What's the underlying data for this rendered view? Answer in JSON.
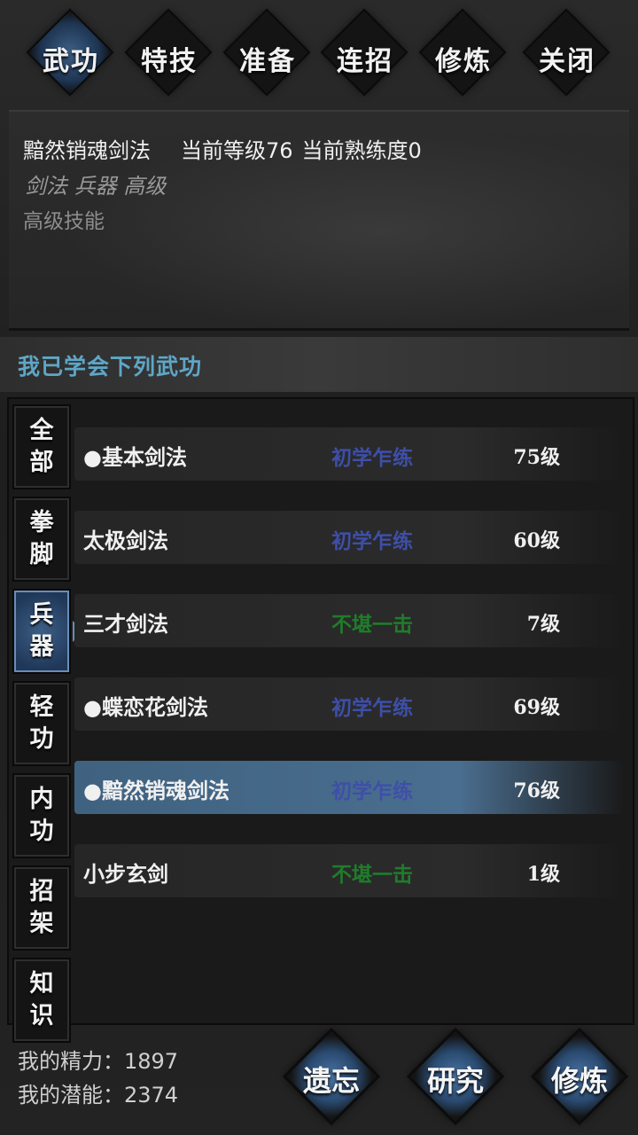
{
  "tabs": [
    {
      "label": "武功",
      "active": true
    },
    {
      "label": "特技",
      "active": false
    },
    {
      "label": "准备",
      "active": false
    },
    {
      "label": "连招",
      "active": false
    },
    {
      "label": "修炼",
      "active": false
    },
    {
      "label": "关闭",
      "active": false
    }
  ],
  "info": {
    "skill_name": "黯然销魂剑法",
    "level_text": "当前等级76",
    "proficiency_text": "当前熟练度0",
    "tags": "剑法 兵器 高级",
    "category": "高级技能"
  },
  "section_title": "我已学会下列武功",
  "categories": [
    {
      "label": "全部",
      "active": false
    },
    {
      "label": "拳脚",
      "active": false
    },
    {
      "label": "兵器",
      "active": true
    },
    {
      "label": "轻功",
      "active": false
    },
    {
      "label": "内功",
      "active": false
    },
    {
      "label": "招架",
      "active": false
    },
    {
      "label": "知识",
      "active": false
    }
  ],
  "skills": [
    {
      "name": "●基本剑法",
      "status": "初学乍练",
      "status_color": "#3e4fa8",
      "level": "75级",
      "selected": false
    },
    {
      "name": "太极剑法",
      "status": "初学乍练",
      "status_color": "#3e4fa8",
      "level": "60级",
      "selected": false
    },
    {
      "name": "三才剑法",
      "status": "不堪一击",
      "status_color": "#1f7d2a",
      "level": "7级",
      "selected": false
    },
    {
      "name": "●蝶恋花剑法",
      "status": "初学乍练",
      "status_color": "#3e4fa8",
      "level": "69级",
      "selected": false
    },
    {
      "name": "●黯然销魂剑法",
      "status": "初学乍练",
      "status_color": "#3e4fa8",
      "level": "76级",
      "selected": true
    },
    {
      "name": "小步玄剑",
      "status": "不堪一击",
      "status_color": "#1f7d2a",
      "level": "1级",
      "selected": false
    }
  ],
  "stats": {
    "energy": "我的精力：1897",
    "potential": "我的潜能：2374"
  },
  "actions": [
    {
      "label": "遗忘"
    },
    {
      "label": "研究"
    },
    {
      "label": "修炼"
    }
  ]
}
